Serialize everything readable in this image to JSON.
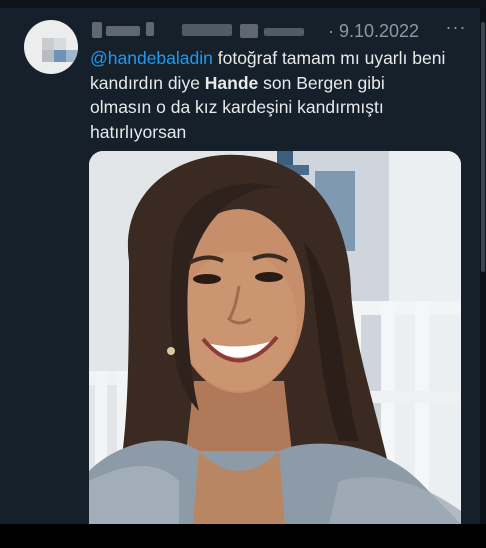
{
  "tweet": {
    "date_text": "· 9.10.2022",
    "more_label": "···",
    "text_mention": "@handebaladin",
    "text_part1": " fotoğraf tamam mı uyarlı beni kandırdın diye ",
    "text_bold": "Hande",
    "text_part2": " son Bergen gibi olmasın o da kız kardeşini kandırmıştı hatırlıyorsan"
  },
  "colors": {
    "background": "#15202b",
    "text": "#e7e9ea",
    "link": "#1d9bf0",
    "secondary_text": "#8b98a5"
  },
  "icons": {
    "more": "more-horizontal-icon"
  }
}
